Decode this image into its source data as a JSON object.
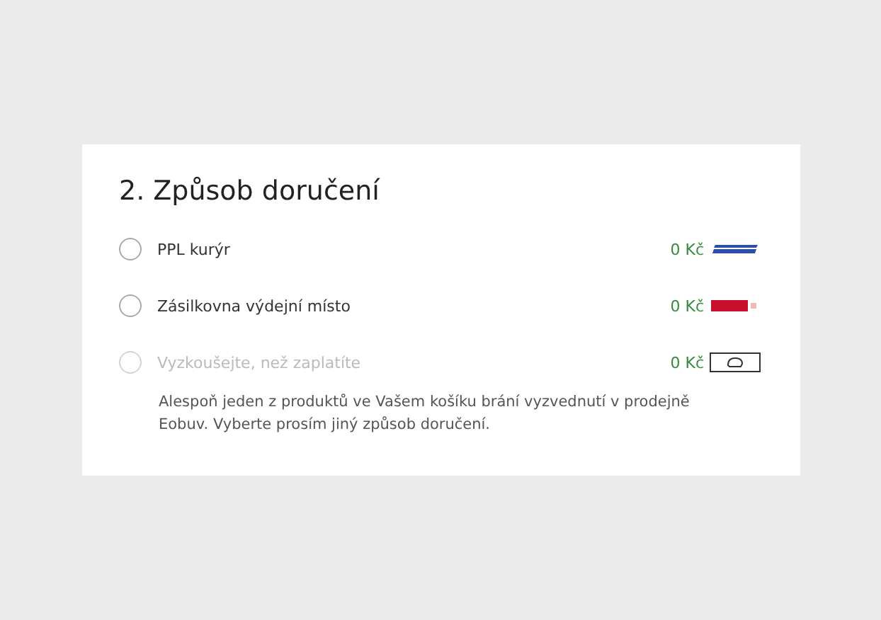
{
  "section": {
    "title": "2. Způsob doručení"
  },
  "options": [
    {
      "label": "PPL kurýr",
      "price": "0 Kč",
      "kind": "ppl",
      "selected": false,
      "disabled": false
    },
    {
      "label": "Zásilkovna výdejní místo",
      "price": "0 Kč",
      "kind": "zasilkovna",
      "selected": false,
      "disabled": false
    },
    {
      "label": "Vyzkoušejte, než zaplatíte",
      "price": "0 Kč",
      "kind": "store",
      "selected": false,
      "disabled": true,
      "note": "Alespoň jeden z produktů ve Vašem košíku brání vyzvednutí v prodejně Eobuv. Vyberte prosím jiný způsob doručení."
    }
  ]
}
